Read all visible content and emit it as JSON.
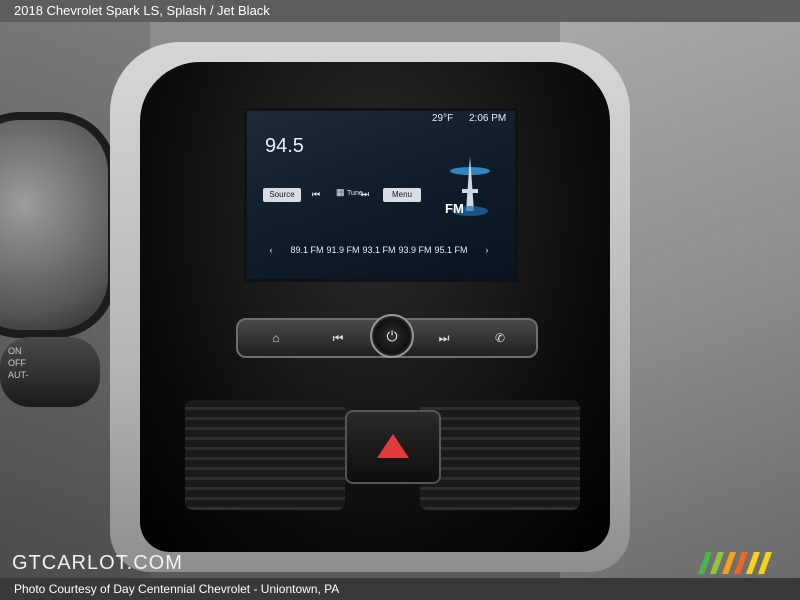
{
  "header": {
    "caption": "2018 Chevrolet Spark LS,  Splash / Jet Black"
  },
  "footer": {
    "credit": "Photo Courtesy of Day Centennial Chevrolet - Uniontown, PA"
  },
  "watermark": {
    "text": "GTCARLOT.COM"
  },
  "infotainment": {
    "frequency": "94.5",
    "temperature": "29°F",
    "time": "2:06 PM",
    "source_label": "Source",
    "menu_label": "Menu",
    "tune_label": "Tune",
    "band_label": "FM",
    "presets": [
      "89.1 FM",
      "91.9 FM",
      "93.1 FM",
      "93.9 FM",
      "95.1 FM"
    ]
  },
  "stalk": {
    "labels": [
      "ON",
      "OFF",
      "AUT-"
    ]
  },
  "icons": {
    "home": "home-icon",
    "previous": "previous-track-icon",
    "power": "power-icon",
    "next": "next-track-icon",
    "phone": "phone-icon",
    "hazard": "hazard-triangle-icon"
  },
  "colors": {
    "hazard": "#e23b3b",
    "screen_bg": "#0f1a28"
  }
}
